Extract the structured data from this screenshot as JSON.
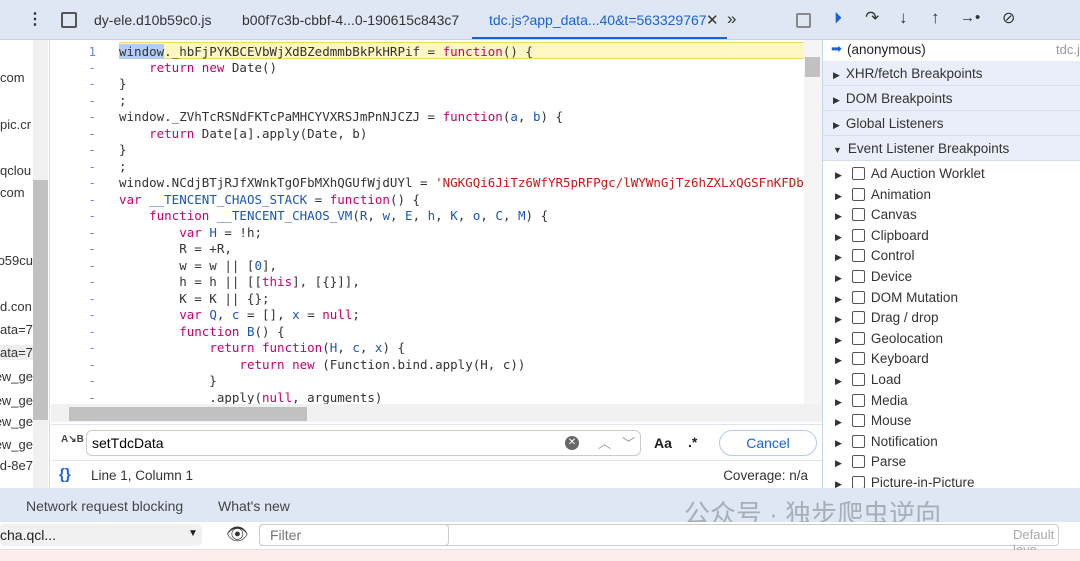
{
  "tabs": [
    {
      "label": "dy-ele.d10b59c0.js"
    },
    {
      "label": "b00f7c3b-cbbf-4...0-190615c843c7"
    },
    {
      "label": "tdc.js?app_data...40&t=563329767",
      "active": true
    }
  ],
  "navigator_items": [
    "com",
    "pic.cr",
    "qclou",
    "com",
    "b59cu",
    "d.con",
    "ata=7",
    "ata=7",
    "ew_ge",
    "ew_ge",
    "ew_ge",
    "ew_ge",
    "d-8e7"
  ],
  "code_lines": [
    {
      "num": "1",
      "tokens": [
        [
          "sel",
          "window"
        ],
        [
          "",
          "._hbFjPYKBCEVbWjXdBZedmmbBkPkHRPif = "
        ],
        [
          "k",
          "function"
        ],
        [
          "",
          "() {"
        ]
      ]
    },
    {
      "num": "-",
      "tokens": [
        [
          "",
          "    "
        ],
        [
          "k",
          "return new"
        ],
        [
          "",
          " Date()"
        ]
      ]
    },
    {
      "num": "-",
      "tokens": [
        [
          "",
          "}"
        ]
      ]
    },
    {
      "num": "-",
      "tokens": [
        [
          "",
          ";"
        ]
      ]
    },
    {
      "num": "-",
      "tokens": [
        [
          "",
          "window._ZVhTcRSNdFKTcPaMHCYVXRSJmPnNJCZJ = "
        ],
        [
          "k",
          "function"
        ],
        [
          "",
          "("
        ],
        [
          "v",
          "a"
        ],
        [
          ", "
        ],
        [
          "v",
          "b"
        ],
        [
          ") {"
        ]
      ]
    },
    {
      "num": "-",
      "tokens": [
        [
          "",
          "    "
        ],
        [
          "k",
          "return"
        ],
        [
          "",
          " Date[a].apply(Date, b)"
        ]
      ]
    },
    {
      "num": "-",
      "tokens": [
        [
          "",
          "}"
        ]
      ]
    },
    {
      "num": "-",
      "tokens": [
        [
          "",
          ";"
        ]
      ]
    },
    {
      "num": "-",
      "tokens": [
        [
          "",
          "window.NCdjBTjRJfXWnkTgOFbMXhQGUfWjdUYl = "
        ],
        [
          "s",
          "'NGKGQi6JiTz6WfYR5pRFPgc/lWYWnGjTz6hZXLxQGSFnKFDb"
        ]
      ]
    },
    {
      "num": "-",
      "tokens": [
        [
          "k",
          "var"
        ],
        [
          "",
          " "
        ],
        [
          "v",
          "__TENCENT_CHAOS_STACK"
        ],
        [
          "",
          " = "
        ],
        [
          "k",
          "function"
        ],
        [
          "",
          "() {"
        ]
      ]
    },
    {
      "num": "-",
      "tokens": [
        [
          "",
          "    "
        ],
        [
          "k",
          "function"
        ],
        [
          "",
          " "
        ],
        [
          "v",
          "__TENCENT_CHAOS_VM"
        ],
        [
          "",
          "("
        ],
        [
          "v",
          "R"
        ],
        [
          ", "
        ],
        [
          "v",
          "w"
        ],
        [
          ", "
        ],
        [
          "v",
          "E"
        ],
        [
          ", "
        ],
        [
          "v",
          "h"
        ],
        [
          ", "
        ],
        [
          "v",
          "K"
        ],
        [
          ", "
        ],
        [
          "v",
          "o"
        ],
        [
          ", "
        ],
        [
          "v",
          "C"
        ],
        [
          ", "
        ],
        [
          "v",
          "M"
        ],
        [
          ") {"
        ]
      ]
    },
    {
      "num": "-",
      "tokens": [
        [
          "",
          "        "
        ],
        [
          "k",
          "var"
        ],
        [
          "",
          " "
        ],
        [
          "v",
          "H"
        ],
        [
          "",
          " = !h;"
        ]
      ]
    },
    {
      "num": "-",
      "tokens": [
        [
          "",
          "        R = +R,"
        ]
      ]
    },
    {
      "num": "-",
      "tokens": [
        [
          "",
          "        w = w || ["
        ],
        [
          "n",
          "0"
        ],
        [
          "",
          "],"
        ]
      ]
    },
    {
      "num": "-",
      "tokens": [
        [
          "",
          "        h = h || [["
        ],
        [
          "k",
          "this"
        ],
        [
          "",
          "], [{}]],"
        ]
      ]
    },
    {
      "num": "-",
      "tokens": [
        [
          "",
          "        K = K || {};"
        ]
      ]
    },
    {
      "num": "-",
      "tokens": [
        [
          "",
          "        "
        ],
        [
          "k",
          "var"
        ],
        [
          "",
          " "
        ],
        [
          "v",
          "Q"
        ],
        [
          ", "
        ],
        [
          "v",
          "c"
        ],
        [
          "",
          " = [], "
        ],
        [
          "v",
          "x"
        ],
        [
          "",
          " = "
        ],
        [
          "k",
          "null"
        ],
        [
          ";"
        ]
      ]
    },
    {
      "num": "-",
      "tokens": [
        [
          "",
          "        "
        ],
        [
          "k",
          "function"
        ],
        [
          "",
          " "
        ],
        [
          "v",
          "B"
        ],
        [
          "",
          "() {"
        ]
      ]
    },
    {
      "num": "-",
      "tokens": [
        [
          "",
          "            "
        ],
        [
          "k",
          "return function"
        ],
        [
          "",
          "("
        ],
        [
          "v",
          "H"
        ],
        [
          ", "
        ],
        [
          "v",
          "c"
        ],
        [
          ", "
        ],
        [
          "v",
          "x"
        ],
        [
          ") {"
        ]
      ]
    },
    {
      "num": "-",
      "tokens": [
        [
          "",
          "                "
        ],
        [
          "k",
          "return new"
        ],
        [
          "",
          " (Function.bind.apply(H, c))"
        ]
      ]
    },
    {
      "num": "-",
      "tokens": [
        [
          "",
          "            }"
        ]
      ]
    },
    {
      "num": "-",
      "tokens": [
        [
          "",
          "            .apply("
        ],
        [
          "k",
          "null"
        ],
        [
          ", arguments)"
        ]
      ]
    }
  ],
  "search": {
    "value": "setTdcData",
    "match_case": "Aa",
    "regex": ".*",
    "cancel": "Cancel"
  },
  "status": {
    "position": "Line 1, Column 1",
    "coverage": "Coverage: n/a"
  },
  "callstack": {
    "frame": "(anonymous)",
    "file": "tdc.j"
  },
  "sections": [
    "XHR/fetch Breakpoints",
    "DOM Breakpoints",
    "Global Listeners",
    "Event Listener Breakpoints"
  ],
  "event_categories": [
    "Ad Auction Worklet",
    "Animation",
    "Canvas",
    "Clipboard",
    "Control",
    "Device",
    "DOM Mutation",
    "Drag / drop",
    "Geolocation",
    "Keyboard",
    "Load",
    "Media",
    "Mouse",
    "Notification",
    "Parse",
    "Picture-in-Picture"
  ],
  "drawer_tabs": [
    "Network request blocking",
    "What's new"
  ],
  "console": {
    "context": "cha.qcl...",
    "filter_placeholder": "Filter",
    "levels": "Default leve"
  },
  "watermark": "公众号 · 独步爬虫逆向"
}
